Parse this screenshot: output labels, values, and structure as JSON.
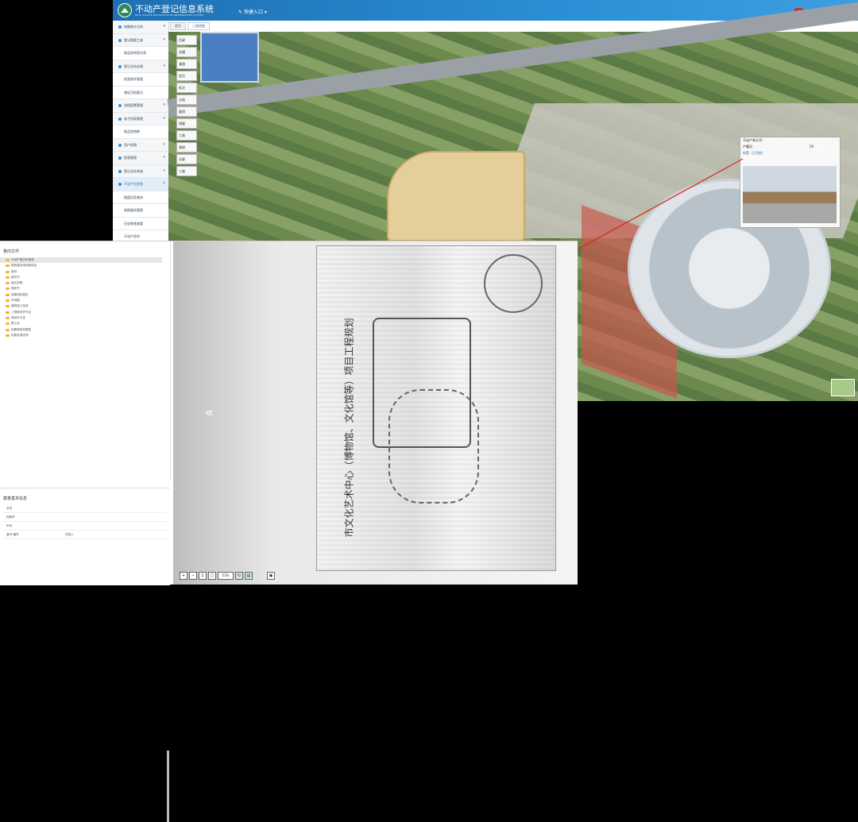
{
  "header": {
    "title": "不动产登记信息系统",
    "subtitle": "REAL ESTATE REGISTRATION INFORMATION SYSTEM",
    "quick_entry": "快捷入口",
    "user_label": "Hello 超管"
  },
  "sidebar": {
    "items": [
      {
        "label": "电脑统计分析",
        "type": "group"
      },
      {
        "label": "登记简版工具",
        "type": "group"
      },
      {
        "label": "商品房网签交易",
        "type": "sub"
      },
      {
        "label": "登记业务办理",
        "type": "group"
      },
      {
        "label": "档案收件管理",
        "type": "sub"
      },
      {
        "label": "缮证归档登记",
        "type": "sub"
      },
      {
        "label": "流程配置管理",
        "type": "group"
      },
      {
        "label": "电子档案管理",
        "type": "group"
      },
      {
        "label": "商品房销售",
        "type": "sub"
      },
      {
        "label": "用户权限",
        "type": "group"
      },
      {
        "label": "报表管理",
        "type": "group"
      },
      {
        "label": "登记业务系统",
        "type": "group"
      },
      {
        "label": "不动产信息图",
        "type": "group",
        "active": true
      },
      {
        "label": "楼盘信息查询",
        "type": "sub"
      },
      {
        "label": "地图服务管理",
        "type": "sub"
      },
      {
        "label": "历史影像查看",
        "type": "sub"
      },
      {
        "label": "不动产综合",
        "type": "sub"
      },
      {
        "label": "不动产信息综合查询",
        "type": "sub"
      }
    ]
  },
  "tabs": [
    {
      "label": "首页"
    },
    {
      "label": "三维地图"
    }
  ],
  "map_tools": [
    {
      "label": "目录"
    },
    {
      "label": "全幅"
    },
    {
      "label": "漫游"
    },
    {
      "label": "定位"
    },
    {
      "label": "标注"
    },
    {
      "label": "点选"
    },
    {
      "label": "量测"
    },
    {
      "label": "测量"
    },
    {
      "label": "工具"
    },
    {
      "label": "清除"
    },
    {
      "label": "分屏"
    },
    {
      "label": "三维"
    }
  ],
  "popup": {
    "row1": "不动产单元号：",
    "row2": "产籍号：",
    "row2_value": "29",
    "link": "档案（已归档）"
  },
  "files": {
    "title": "卷内文件",
    "items": [
      {
        "label": "不动产登记申请表",
        "selected": true
      },
      {
        "label": "国有建设用地使用证"
      },
      {
        "label": "规划"
      },
      {
        "label": "委托书"
      },
      {
        "label": "营业执照"
      },
      {
        "label": "授权书"
      },
      {
        "label": "房屋测绘报告"
      },
      {
        "label": "宗地图"
      },
      {
        "label": "建筑竣工验收"
      },
      {
        "label": "工程规划许可证"
      },
      {
        "label": "规划许可证"
      },
      {
        "label": "图上证"
      },
      {
        "label": "权籍调查成果表"
      },
      {
        "label": "权属来源证明"
      }
    ]
  },
  "info": {
    "title": "案卷基本信息",
    "rows": [
      {
        "label": "全宗",
        "value": ""
      },
      {
        "label": "档案号",
        "value": ""
      },
      {
        "label": "年份",
        "value": ""
      },
      {
        "label": "盒号 编号",
        "value": "归档人"
      }
    ]
  },
  "viewer": {
    "prev_symbol": "«",
    "scan_caption": "市文化艺术中心（博物馆、文化馆等）项目工程规划",
    "zoom": "53%"
  }
}
